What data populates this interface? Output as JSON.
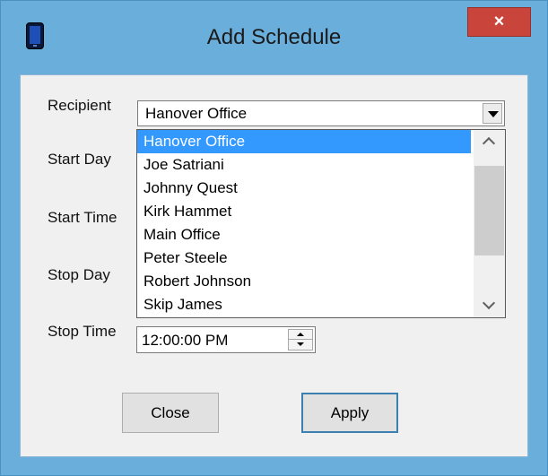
{
  "window": {
    "title": "Add Schedule",
    "close_glyph": "×",
    "app_icon": "phone-icon",
    "close_color": "#c9443b",
    "frame_color": "#6aaedb"
  },
  "labels": {
    "recipient": "Recipient",
    "start_day": "Start Day",
    "start_time": "Start Time",
    "stop_day": "Stop Day",
    "stop_time": "Stop Time"
  },
  "recipient": {
    "value": "Hanover Office",
    "options": [
      "Hanover Office",
      "Joe Satriani",
      "Johnny Quest",
      "Kirk Hammet",
      "Main Office",
      "Peter Steele",
      "Robert Johnson",
      "Skip James"
    ],
    "selected_index": 0,
    "highlight_color": "#3399ff"
  },
  "stop_time": {
    "value": "12:00:00 PM"
  },
  "buttons": {
    "close": "Close",
    "apply": "Apply"
  }
}
